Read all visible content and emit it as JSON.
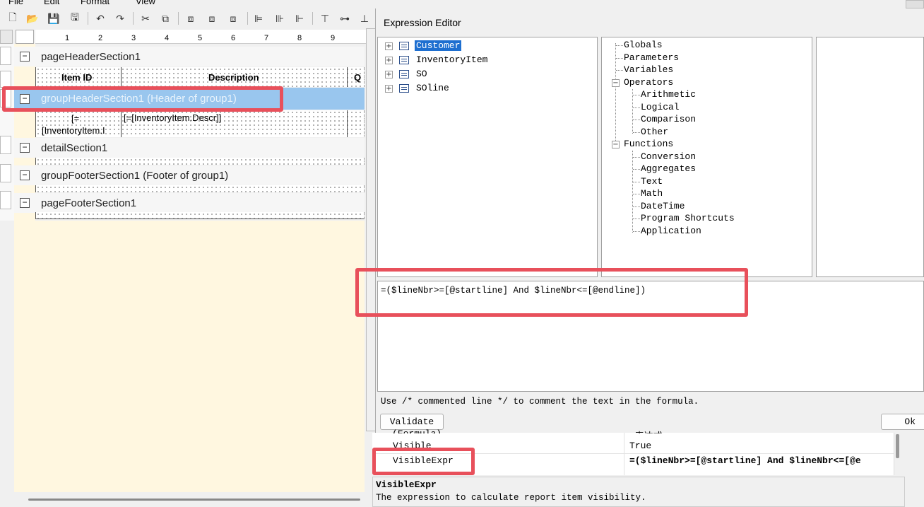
{
  "menu": [
    "File",
    "Edit",
    "Format",
    "View"
  ],
  "ruler_ticks": [
    "1",
    "2",
    "3",
    "4",
    "5",
    "6",
    "7",
    "8",
    "9"
  ],
  "sections": {
    "page_header": "pageHeaderSection1",
    "group_header": "groupHeaderSection1 (Header of group1)",
    "detail": "detailSection1",
    "group_footer": "groupFooterSection1 (Footer of group1)",
    "page_footer": "pageFooterSection1"
  },
  "page_header_cells": {
    "item_id": "Item ID",
    "description": "Description",
    "q": "Q"
  },
  "group_header_cells": {
    "eq": "[=",
    "inventory_item": "[InventoryItem.I",
    "descr": "[=[InventoryItem.Descr]]"
  },
  "expression_editor": {
    "title": "Expression Editor",
    "tables": [
      "Customer",
      "InventoryItem",
      "SO",
      "SOline"
    ],
    "functions_tree": {
      "globals": "Globals",
      "parameters": "Parameters",
      "variables": "Variables",
      "operators": "Operators",
      "operator_children": [
        "Arithmetic",
        "Logical",
        "Comparison",
        "Other"
      ],
      "functions": "Functions",
      "function_children": [
        "Conversion",
        "Aggregates",
        "Text",
        "Math",
        "DateTime",
        "Program Shortcuts",
        "Application"
      ]
    },
    "formula": "=($lineNbr>=[@startline] And $lineNbr<=[@endline])",
    "hint": "Use /* commented line */ to comment the text in the formula.",
    "validate_label": "Validate",
    "ok_label": "Ok"
  },
  "properties": {
    "partial_row_label": "(Formula)",
    "partial_row_value": "<表达式>",
    "rows": [
      {
        "name": "Visible",
        "value": "True"
      },
      {
        "name": "VisibleExpr",
        "value": "=($lineNbr>=[@startline] And $lineNbr<=[@e"
      }
    ],
    "desc_title": "VisibleExpr",
    "desc_text": "The expression to calculate report item visibility."
  },
  "colors": {
    "highlight_box": "#e8505b",
    "selection": "#1e6fd0",
    "section_selected": "#99c6ee"
  }
}
